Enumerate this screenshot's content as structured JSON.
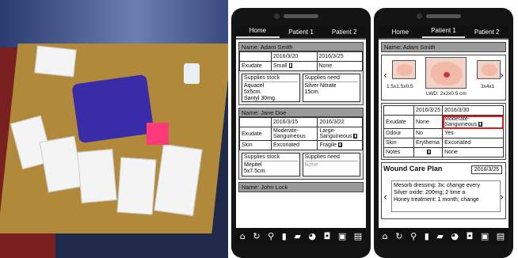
{
  "phone1": {
    "tabs": [
      "Home",
      "Patient 1",
      "Patient 2"
    ],
    "patients": [
      {
        "name": "Name: Adam Smith",
        "dates": [
          "2016/3/20",
          "2016/3/25"
        ],
        "rows": [
          {
            "label": "Exudate",
            "values": [
              "Small",
              "None"
            ]
          }
        ],
        "supplies_stock_title": "Supplies stock",
        "supplies_stock": [
          "Aquacel",
          "5x5cm.",
          "Santyl 30mg."
        ],
        "supplies_need_title": "Supplies need",
        "supplies_need": [
          "Silver Nitrate",
          "15cm."
        ]
      },
      {
        "name": "Name: Jane Doe",
        "dates": [
          "2016/3/15",
          "2016/3/22"
        ],
        "rows": [
          {
            "label": "Exudate",
            "values": [
              "Moderate-Sanguineous",
              "Large-Sanguineous"
            ]
          },
          {
            "label": "Skin",
            "values": [
              "Excoriated",
              "Fragile"
            ]
          }
        ],
        "supplies_stock_title": "Supplies stock",
        "supplies_stock": [
          "Mepitel",
          "5x7.5cm."
        ],
        "supplies_need_title": "Supplies need",
        "supplies_need": [
          "None"
        ]
      },
      {
        "name": "Name: John Lock"
      }
    ],
    "toolbar_icons": [
      "home-icon",
      "sync-icon",
      "search-icon",
      "book-icon",
      "chat-icon",
      "pie-chart-icon",
      "camera-icon",
      "id-card-icon",
      "clipboard-icon"
    ]
  },
  "phone2": {
    "tabs": [
      "Home",
      "Patient 1",
      "Patient 2"
    ],
    "name": "Name: Adam Smith",
    "wound_left_label": "1.5x1.5x0.5",
    "wound_center_label": "LWD: 2x2x0.5 cm",
    "wound_right_label": "3x4x1",
    "dates": [
      "2016/3/25",
      "2016/3/30"
    ],
    "rows": [
      {
        "label": "Exudate",
        "values": [
          "None",
          "Moderate-Sanguineous"
        ]
      },
      {
        "label": "Odour",
        "values": [
          "No",
          "Yes"
        ]
      },
      {
        "label": "Skin",
        "values": [
          "Erythema",
          "Excoriated"
        ]
      },
      {
        "label": "Notes",
        "values": [
          "",
          "None"
        ]
      }
    ],
    "plan_title": "Wound Care Plan",
    "plan_date": "2016/3/25",
    "plan_lines": [
      "Mesorb dressing: 3x; change every",
      "Silver oxide: 200mg; 2 time a",
      "Honey treatment: 1 month; change"
    ],
    "highlight_color": "#e01a1a"
  }
}
